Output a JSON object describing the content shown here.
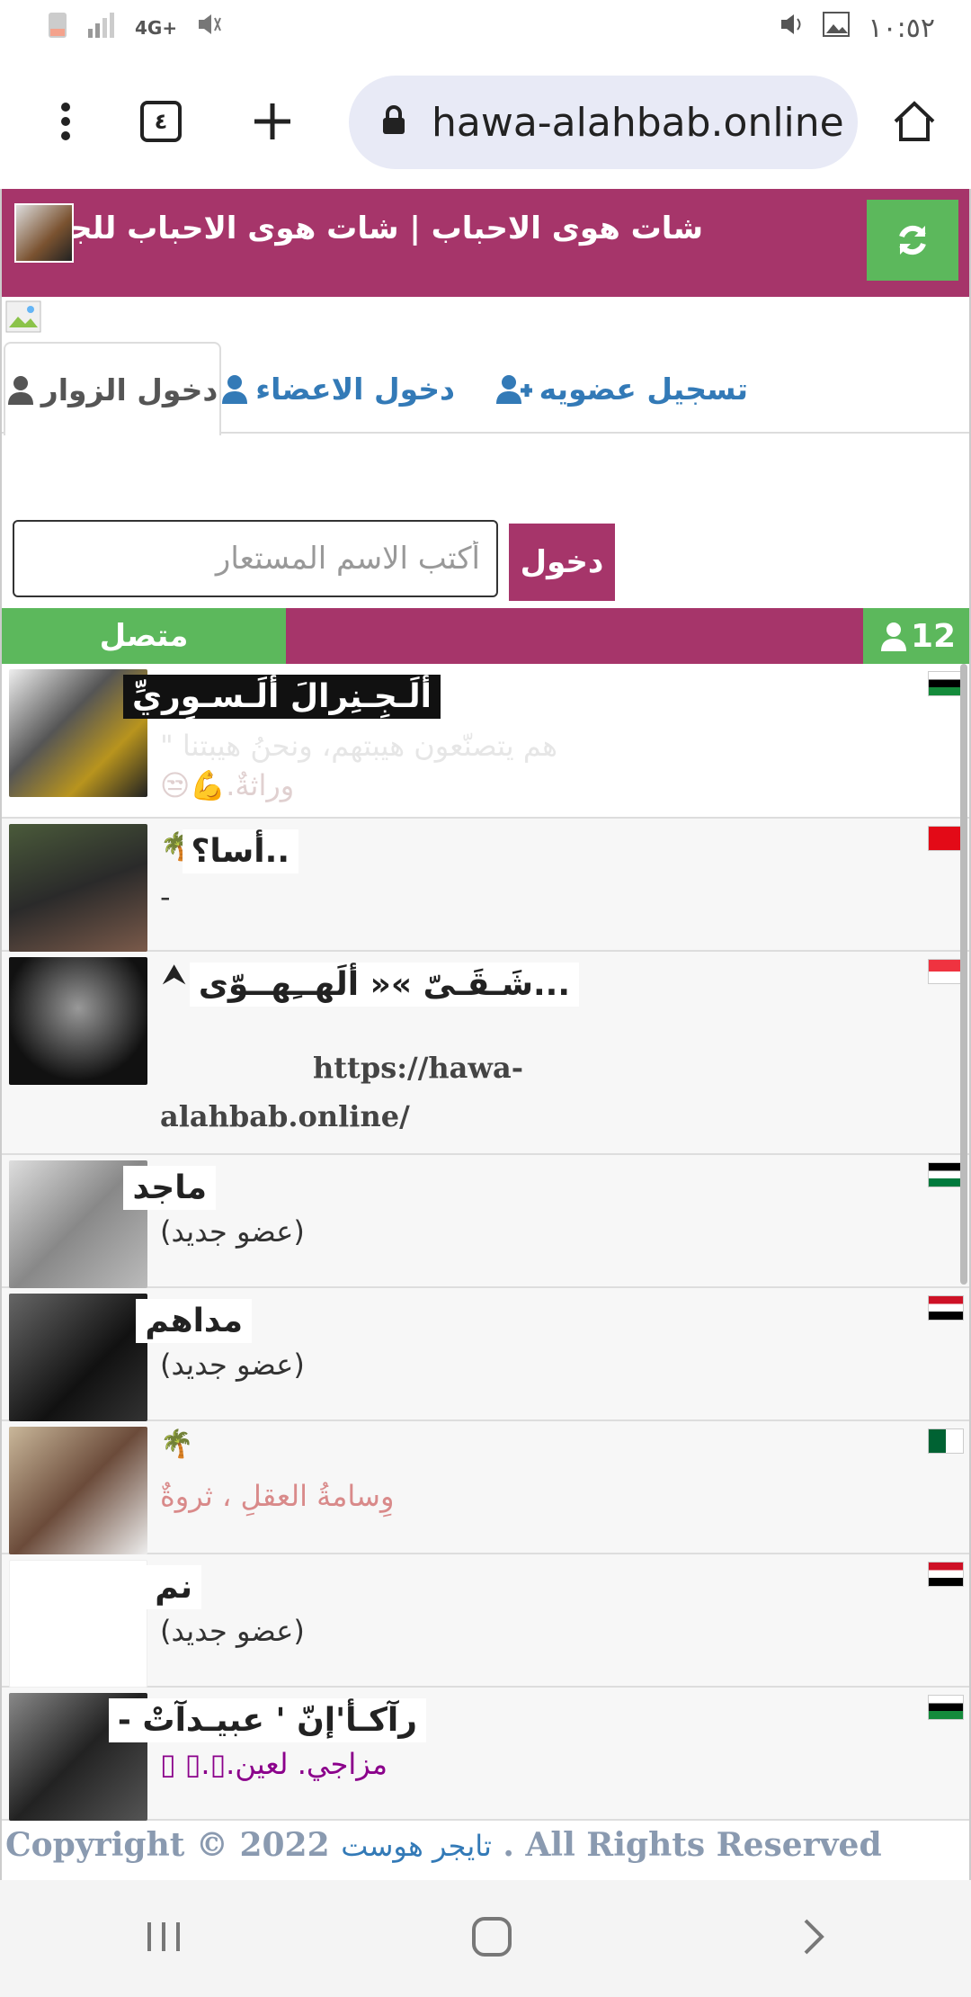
{
  "status_bar": {
    "time": "١٠:٥٢",
    "network": "4G+",
    "icons": [
      "battery-icon",
      "signal-icon",
      "mute-icon",
      "volume-icon",
      "image-icon"
    ]
  },
  "browser": {
    "tabs_count": "٤",
    "url": "hawa-alahbab.online"
  },
  "header": {
    "title": "شات هوى الاحباب | شات هوى الاحباب للجوال",
    "accent": "#a6356a",
    "refresh_color": "#5cb85c"
  },
  "tabs": {
    "visitors": "دخول الزوار",
    "members": "دخول الاعضاء",
    "register": "تسجيل عضويه"
  },
  "login": {
    "placeholder": "أكتب الاسم المستعار",
    "button": "دخول"
  },
  "online_bar": {
    "count": "12",
    "label": "متصل"
  },
  "users": [
    {
      "name": "ألَـجِـنِرالَ ألَـسـوِريِّ",
      "status_line1": "هم يتصنّعون هيبتهم، ونحنُ هيبتنا \"",
      "status_line2": "وراثةٌ.",
      "emoji": "💪😒"
    },
    {
      "name": "..أسا؟",
      "status_line1": "-"
    },
    {
      "name": "...شَـقَـىّ »« ألَهــِهــوّى",
      "status_line1": "https://hawa-",
      "status_line2": "alahbab.online/"
    },
    {
      "name": "ماجد",
      "status_line1": "(عضو جديد)"
    },
    {
      "name": "مداهم",
      "status_line1": "(عضو جديد)"
    },
    {
      "name": "",
      "status_line1": "وِسامةُ العقلِ ، ثروةٌ"
    },
    {
      "name": "نم",
      "status_line1": "(عضو جديد)"
    },
    {
      "name": "رآكـأ'إنّ ' عبيـدآتْ -",
      "status_line1": "مزاجي. لعين.▯.▯ ▯"
    }
  ],
  "footer": {
    "prefix": "Copyright © 2022",
    "link": "تايجر هوست",
    "suffix": ". All Rights Reserved"
  }
}
